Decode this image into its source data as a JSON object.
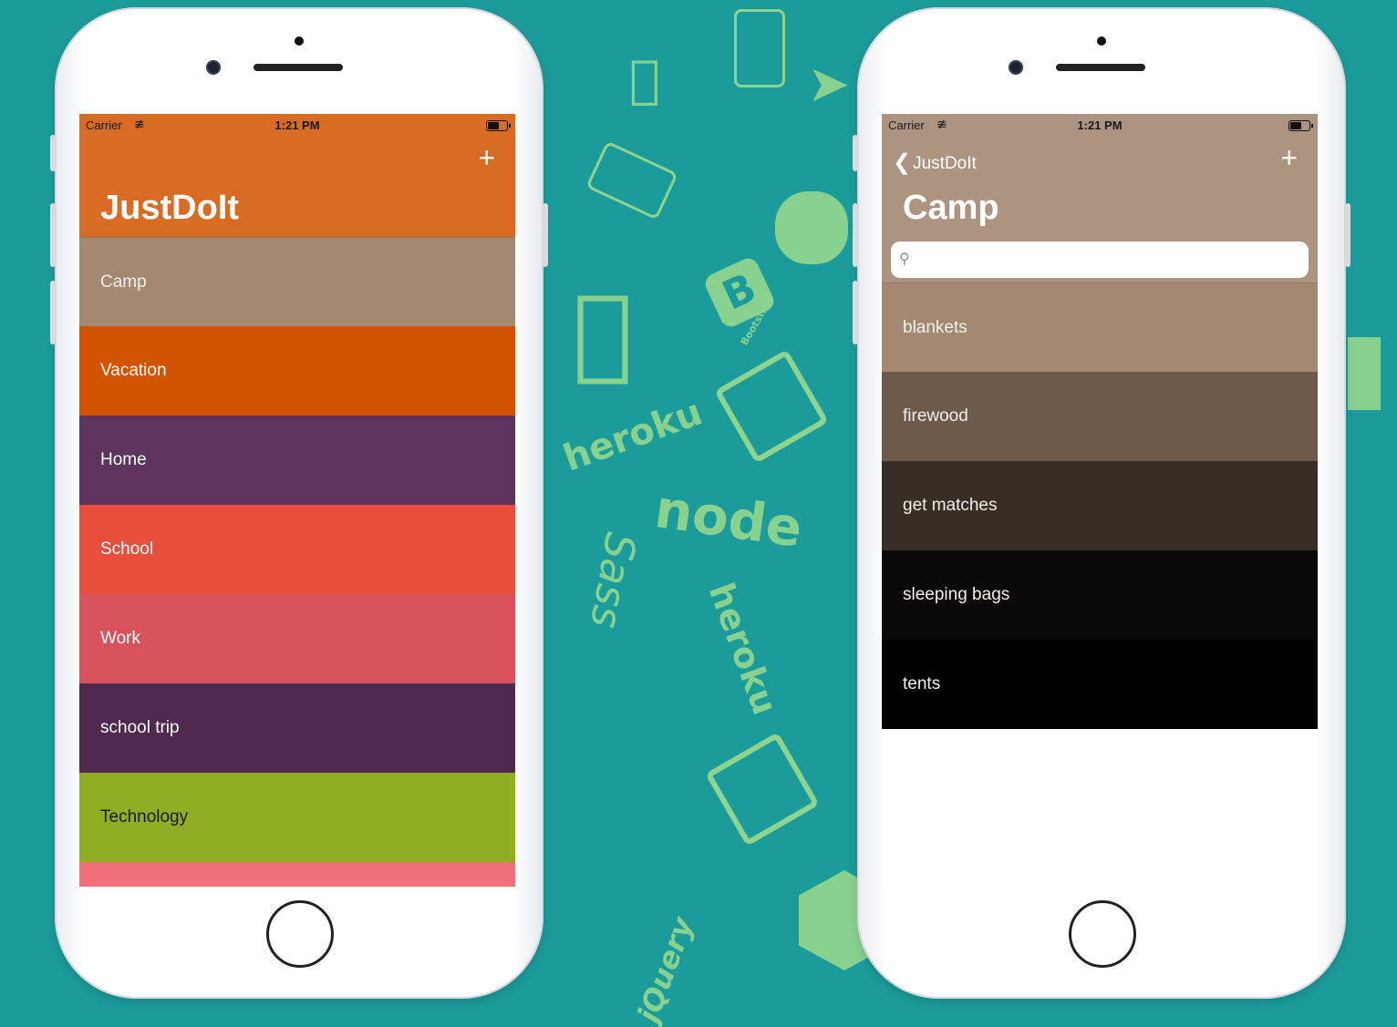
{
  "background": {
    "color": "#1c9b9b",
    "decor_color": "#8fd48e",
    "decor_words": [
      "heroku",
      "node",
      "heroku",
      "Bootstrap",
      "Sass",
      "jQuery"
    ]
  },
  "phone_left": {
    "status": {
      "carrier": "Carrier",
      "time": "1:21 PM"
    },
    "navbar": {
      "title": "JustDoIt",
      "add_label": "+",
      "color": "#d96c25"
    },
    "categories": [
      {
        "label": "Camp",
        "color": "#a48872",
        "text_color": "#f3efe9"
      },
      {
        "label": "Vacation",
        "color": "#d25400",
        "text_color": "#ffffff"
      },
      {
        "label": "Home",
        "color": "#5d345e",
        "text_color": "#ffffff"
      },
      {
        "label": "School",
        "color": "#e74f3d",
        "text_color": "#ffffff"
      },
      {
        "label": "Work",
        "color": "#d8525c",
        "text_color": "#ffffff"
      },
      {
        "label": "school trip",
        "color": "#4f2a4e",
        "text_color": "#ffffff"
      },
      {
        "label": "Technology",
        "color": "#90ae23",
        "text_color": "#1b1b1b"
      },
      {
        "label": "",
        "color": "#ef6f7b",
        "text_color": "#ffffff"
      }
    ]
  },
  "phone_right": {
    "status": {
      "carrier": "Carrier",
      "time": "1:21 PM"
    },
    "navbar": {
      "back_label": "JustDoIt",
      "title": "Camp",
      "add_label": "+",
      "color": "#ad9480"
    },
    "search": {
      "placeholder": "",
      "value": ""
    },
    "items": [
      {
        "label": "blankets",
        "color": "#a48872",
        "text_color": "#f3efe9"
      },
      {
        "label": "firewood",
        "color": "#6e5a4b",
        "text_color": "#f3efe9"
      },
      {
        "label": "get matches",
        "color": "#392e26",
        "text_color": "#f3efe9"
      },
      {
        "label": "sleeping bags",
        "color": "#0b0908",
        "text_color": "#f3efe9"
      },
      {
        "label": "tents",
        "color": "#000000",
        "text_color": "#f3efe9"
      }
    ]
  }
}
